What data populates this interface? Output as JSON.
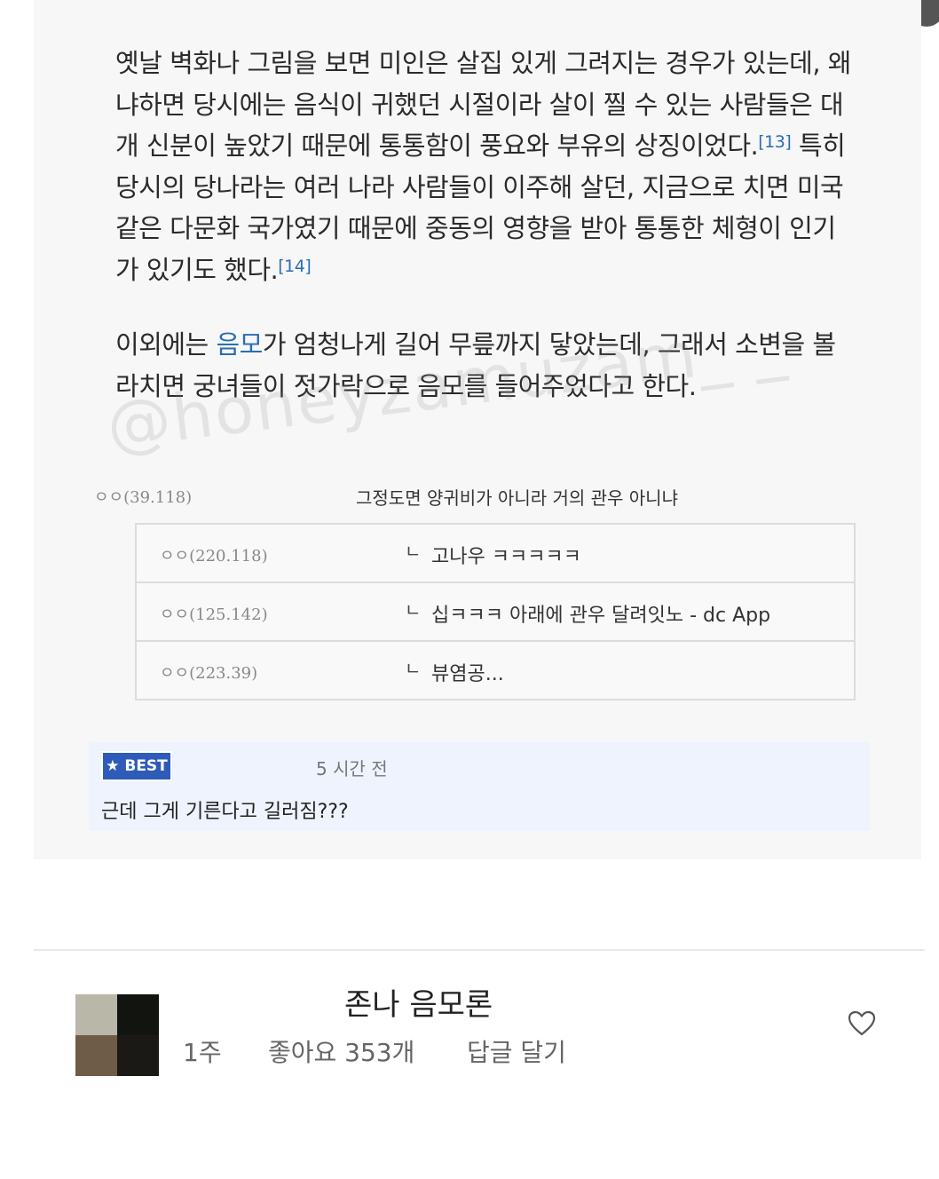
{
  "article": {
    "para1": "옛날 벽화나 그림을 보면 미인은 살집 있게 그려지는 경우가 있는데, 왜냐하면 당시에는 음식이 귀했던 시절이라 살이 찔 수 있는 사람들은 대개 신분이 높았기 때문에 통통함이 풍요와 부유의 상징이었다.",
    "ref13": "[13]",
    "para1b": " 특히 당시의 당나라는 여러 나라 사람들이 이주해 살던, 지금으로 치면 미국 같은 다문화 국가였기 때문에 중동의 영향을 받아 통통한 체형이 인기가 있기도 했다.",
    "ref14": "[14]",
    "para2_pre": "이외에는 ",
    "para2_link": "음모",
    "para2_post": "가 엄청나게 길어 무릎까지 닿았는데, 그래서 소변을 볼라치면 궁녀들이 젓가락으로 음모를 들어주었다고 한다."
  },
  "watermark": "@honeyzamuzam_ _",
  "dc_comments": {
    "parent": {
      "ip": "ㅇㅇ(39.118)",
      "text": "그정도면 양귀비가 아니라 거의 관우 아니냐"
    },
    "replies": [
      {
        "ip": "ㅇㅇ(220.118)",
        "arrow": "ㄴ",
        "text": "고나우 ㅋㅋㅋㅋㅋ"
      },
      {
        "ip": "ㅇㅇ(125.142)",
        "arrow": "ㄴ",
        "text": "십ㅋㅋㅋ 아래에 관우 달려잇노 - dc App"
      },
      {
        "ip": "ㅇㅇ(223.39)",
        "arrow": "ㄴ",
        "text": "뷰염공..."
      }
    ]
  },
  "best": {
    "badge": "★ BEST",
    "time": "5 시간 전",
    "text": "근데 그게 기른다고 길러짐???"
  },
  "comment": {
    "text": "존나 음모론",
    "age": "1주",
    "likes": "좋아요 353개",
    "reply": "답글 달기"
  },
  "colors": {
    "link": "#2a6db3",
    "best_badge": "#2e5bb8",
    "best_bg": "#eef3fd"
  }
}
